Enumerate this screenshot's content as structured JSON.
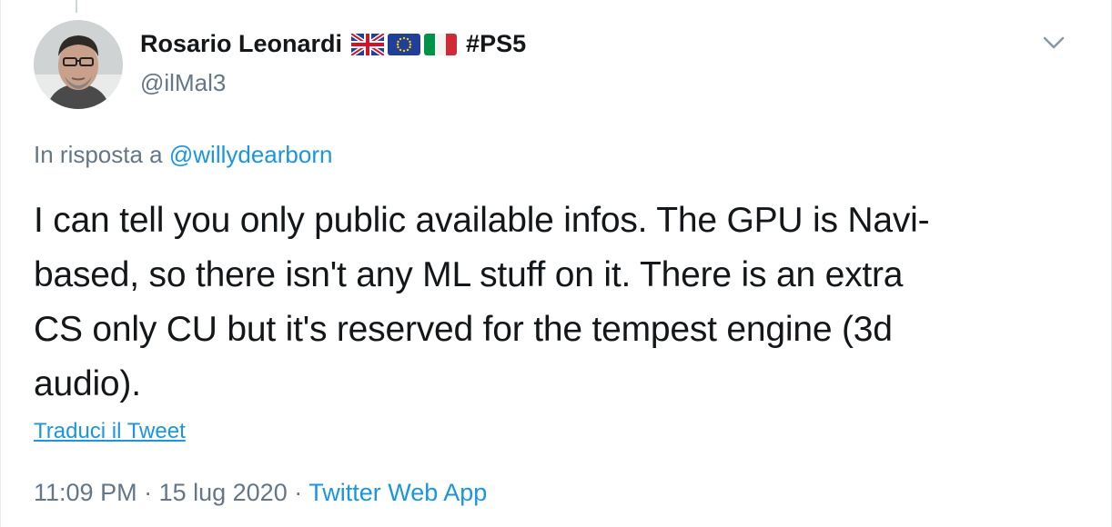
{
  "author": {
    "display_name": "Rosario Leonardi",
    "handle": "@ilMal3",
    "hashtag": "#PS5",
    "flags": [
      "uk-flag-icon",
      "eu-flag-icon",
      "italy-flag-icon"
    ]
  },
  "reply": {
    "prefix": "In risposta a",
    "mention": "@willydearborn"
  },
  "tweet": {
    "text": "I can tell you only public available infos. The GPU is Navi-based, so there isn't any ML stuff on it. There is an extra CS only CU but it's reserved for the tempest engine (3d audio).",
    "lines": [
      "I can tell you only public available infos. The GPU is Navi-",
      "based, so there isn't any ML stuff on it. There is an extra",
      "CS only CU but it's reserved for the tempest engine (3d",
      "audio)."
    ]
  },
  "translate_label": "Traduci il Tweet",
  "meta": {
    "time": "11:09 PM",
    "separator": " · ",
    "date": "15 lug 2020",
    "source": "Twitter Web App"
  },
  "colors": {
    "text": "#14171a",
    "secondary": "#657786",
    "link": "#1b95e0",
    "border": "#e6ecf0"
  }
}
